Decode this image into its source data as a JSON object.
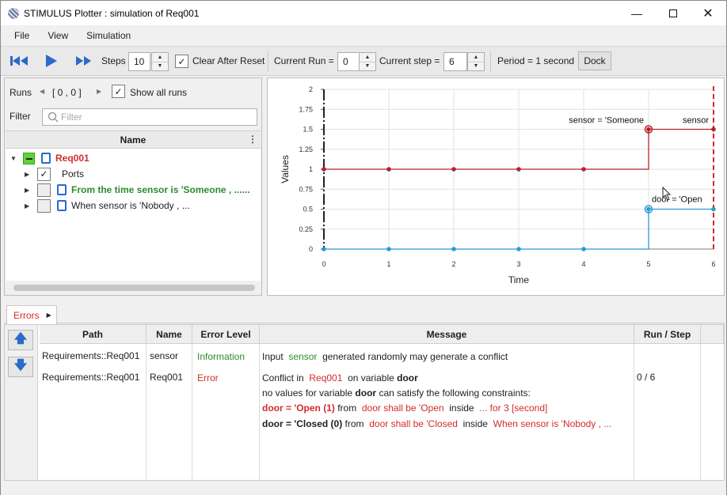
{
  "window": {
    "title": "STIMULUS Plotter : simulation of Req001"
  },
  "menu": [
    "File",
    "View",
    "Simulation"
  ],
  "toolbar": {
    "steps_label": "Steps",
    "steps_value": "10",
    "clear_label": "Clear After Reset",
    "current_run_label": "Current Run =",
    "current_run_value": "0",
    "current_step_label": "Current step =",
    "current_step_value": "6",
    "period_label": "Period = 1 second",
    "dock_label": "Dock"
  },
  "runs": {
    "label": "Runs",
    "range": "[ 0 , 0 ]",
    "show_all_label": "Show all runs",
    "filter_label": "Filter",
    "filter_placeholder": "Filter",
    "column_name": "Name",
    "tree": [
      {
        "label": "Req001",
        "color": "#d42b2b"
      },
      {
        "label": "Ports",
        "color": "#1e1e1e"
      },
      {
        "label": "From the time  sensor is  'Someone , ......",
        "color": "#2d8a2d"
      },
      {
        "label": "When  sensor is  'Nobody , ...",
        "color": "#1e1e1e"
      }
    ]
  },
  "chart_data": {
    "type": "line",
    "xlabel": "Time",
    "ylabel": "Values",
    "xlim": [
      0,
      6
    ],
    "ylim": [
      0,
      2
    ],
    "x_ticks": [
      "0",
      "1",
      "2",
      "3",
      "4",
      "5",
      "6"
    ],
    "y_ticks": [
      "0",
      "0.25",
      "0.5",
      "0.75",
      "1",
      "1.25",
      "1.5",
      "1.75",
      "2"
    ],
    "series": [
      {
        "name": "sensor",
        "color": "#b5242a",
        "x": [
          0,
          1,
          2,
          3,
          4,
          5,
          6
        ],
        "y": [
          1,
          1,
          1,
          1,
          1,
          1.5,
          1.5
        ]
      },
      {
        "name": "door",
        "color": "#2a9bd4",
        "x": [
          0,
          1,
          2,
          3,
          4,
          5,
          6
        ],
        "y": [
          0,
          0,
          0,
          0,
          0,
          0.5,
          0.5
        ]
      }
    ],
    "annotations": [
      "sensor = 'Someone",
      "sensor",
      "door = 'Open"
    ],
    "current_time": 6
  },
  "errors": {
    "tab_label": "Errors",
    "columns": [
      "Path",
      "Name",
      "Error Level",
      "Message",
      "Run / Step"
    ],
    "rows": [
      {
        "path": "Requirements::Req001",
        "name": "sensor",
        "level": "Information",
        "msg_a": "Input",
        "msg_b": "sensor",
        "msg_c": "generated randomly may generate a conflict",
        "run_step": ""
      },
      {
        "path": "Requirements::Req001",
        "name": "Req001",
        "level": "Error",
        "l1a": "Conflict in",
        "l1b": "Req001",
        "l1c": "on variable",
        "l1d": "door",
        "l2a": "no values for variable",
        "l2b": "door",
        "l2c": "can satisfy the following constraints:",
        "l3a": "door = 'Open (1)",
        "l3b": "from",
        "l3c": "door shall be  'Open",
        "l3d": "inside",
        "l3e": "... for  3 [second]",
        "l4a": "door = 'Closed (0)",
        "l4b": "from",
        "l4c": "door shall be  'Closed",
        "l4d": "inside",
        "l4e": "When  sensor is  'Nobody , ...",
        "run_step": "0 / 6"
      }
    ]
  }
}
